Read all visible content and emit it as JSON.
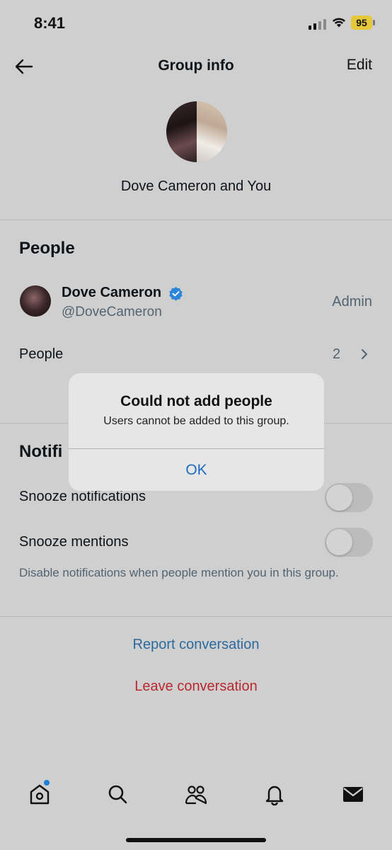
{
  "status_bar": {
    "time": "8:41",
    "battery": "95"
  },
  "header": {
    "title": "Group info",
    "edit_label": "Edit"
  },
  "group": {
    "name": "Dove Cameron and You"
  },
  "people_section": {
    "title": "People",
    "member": {
      "name": "Dove Cameron",
      "handle": "@DoveCameron",
      "role": "Admin"
    },
    "people_row": {
      "label": "People",
      "count": "2"
    }
  },
  "notifications_section": {
    "title_visible": "Notifi",
    "snooze_notifications_label": "Snooze notifications",
    "snooze_mentions_label": "Snooze mentions",
    "description": "Disable notifications when people mention you in this group."
  },
  "actions": {
    "report_label": "Report conversation",
    "leave_label": "Leave conversation"
  },
  "dialog": {
    "title": "Could not add people",
    "message": "Users cannot be added to this group.",
    "ok_label": "OK"
  },
  "tab_bar": {
    "icons": [
      "home-icon",
      "search-icon",
      "communities-icon",
      "notifications-icon",
      "messages-icon"
    ]
  },
  "colors": {
    "accent_blue": "#1f6bc4",
    "report_blue": "#2c6a9e",
    "danger_red": "#b8282e",
    "battery_yellow": "#e5c83a"
  }
}
